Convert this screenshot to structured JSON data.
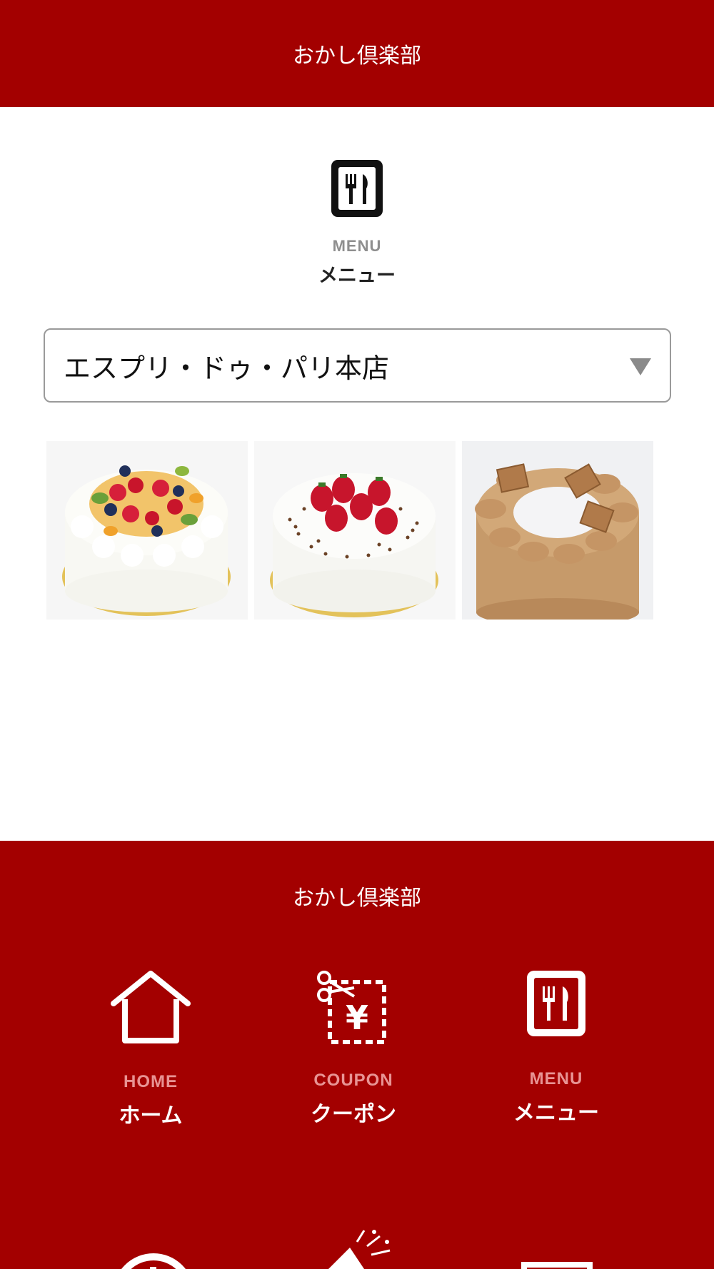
{
  "header": {
    "title": "おかし倶楽部"
  },
  "menu_heading": {
    "en": "MENU",
    "jp": "メニュー",
    "icon": "menu-fork-knife-icon"
  },
  "store_select": {
    "value": "エスプリ・ドゥ・パリ本店"
  },
  "products": [
    {
      "name": "fruit-cake-image"
    },
    {
      "name": "strawberry-cake-image"
    },
    {
      "name": "chocolate-cake-image"
    }
  ],
  "footer": {
    "title": "おかし倶楽部",
    "nav": [
      {
        "en": "HOME",
        "jp": "ホーム",
        "icon": "home-icon"
      },
      {
        "en": "COUPON",
        "jp": "クーポン",
        "icon": "coupon-icon"
      },
      {
        "en": "MENU",
        "jp": "メニュー",
        "icon": "menu-icon"
      }
    ],
    "nav_row2_icons": [
      "clock-icon",
      "party-popper-icon",
      "mail-icon"
    ]
  },
  "colors": {
    "brand_red": "#a30000",
    "light_gray_text": "#8e8e8e",
    "nav_en_pink": "#e89494"
  }
}
